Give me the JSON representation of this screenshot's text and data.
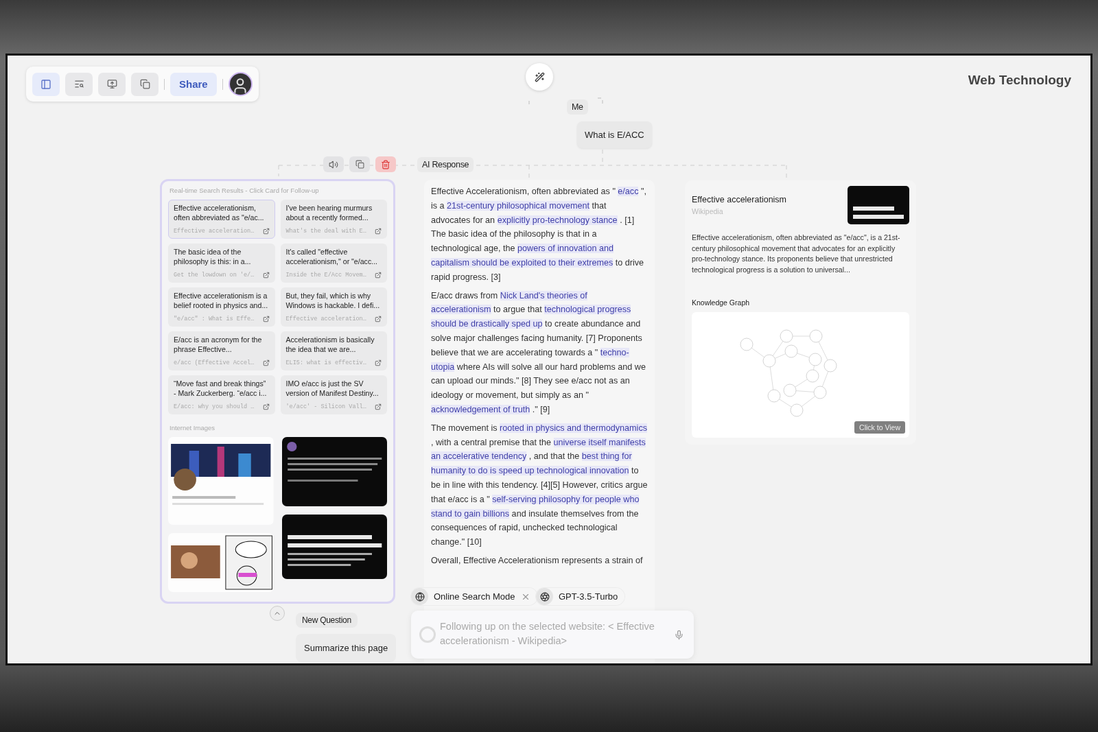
{
  "toolbar": {
    "buttons": [
      {
        "kind": "sidebar",
        "selected": true
      },
      {
        "kind": "search",
        "selected": false
      },
      {
        "kind": "add",
        "selected": false
      },
      {
        "kind": "copy",
        "selected": false
      }
    ],
    "share": "Share"
  },
  "page_title": "Web Technology",
  "tree": {
    "user_label": "Me",
    "question": "What is E/ACC",
    "response_label": "AI Response"
  },
  "actions": [
    {
      "kind": "speaker"
    },
    {
      "kind": "copy"
    },
    {
      "kind": "delete"
    }
  ],
  "search_panel": {
    "title": "Real-time Search Results - Click Card for Follow-up",
    "results": [
      {
        "title": "Effective accelerationism, often abbreviated as \"e/ac...",
        "source": "Effective acceleration…",
        "selected": true
      },
      {
        "title": "I've been hearing murmurs about a recently formed...",
        "source": "What's the deal with E…",
        "selected": false
      },
      {
        "title": "The basic idea of the philosophy is this: in a...",
        "source": "Get the lowdown on 'e/…",
        "selected": false
      },
      {
        "title": "It's called \"effective accelerationism,\" or \"e/acc...",
        "source": "Inside the E/Acc Movem…",
        "selected": false
      },
      {
        "title": "Effective accelerationism is a belief rooted in physics and...",
        "source": "\"e/acc\" : What is Effe…",
        "selected": false
      },
      {
        "title": "But, they fail, which is why Windows is hackable. I defi...",
        "source": "Effective acceleration…",
        "selected": false
      },
      {
        "title": "E/acc is an acronym for the phrase Effective...",
        "source": "e/acc (Effective Accel…",
        "selected": false
      },
      {
        "title": "Accelerationism is basically the idea that we are...",
        "source": "ELI5: what is effectiv…",
        "selected": false
      },
      {
        "title": "“Move fast and break things” - Mark Zuckerberg. “e/acc i...",
        "source": "E/acc: why you should …",
        "selected": false
      },
      {
        "title": "IMO e/acc is just the SV version of Manifest Destiny...",
        "source": "'e/acc' - Silicon Vall…",
        "selected": false
      }
    ],
    "images_label": "Internet Images"
  },
  "answer": {
    "paragraphs": [
      [
        {
          "text": "Effective Accelerationism, often abbreviated as \" ",
          "highlight": false
        },
        {
          "text": "e/acc",
          "highlight": true
        },
        {
          "text": " \", is a ",
          "highlight": false
        },
        {
          "text": "21st-century philosophical movement",
          "highlight": true
        },
        {
          "text": " that advocates for an ",
          "highlight": false
        },
        {
          "text": "explicitly pro-technology stance",
          "highlight": true
        },
        {
          "text": " . [1] The basic idea of the philosophy is that in a technological age, the ",
          "highlight": false
        },
        {
          "text": "powers of innovation and capitalism should be exploited to their extremes",
          "highlight": true
        },
        {
          "text": " to drive rapid progress. [3]",
          "highlight": false
        }
      ],
      [
        {
          "text": "E/acc draws from ",
          "highlight": false
        },
        {
          "text": "Nick Land's theories of accelerationism",
          "highlight": true
        },
        {
          "text": " to argue that ",
          "highlight": false
        },
        {
          "text": "technological progress should be drastically sped up",
          "highlight": true
        },
        {
          "text": " to create abundance and solve major challenges facing humanity. [7] Proponents believe that we are accelerating towards a \" ",
          "highlight": false
        },
        {
          "text": "techno-utopia",
          "highlight": true
        },
        {
          "text": " where AIs will solve all our hard problems and we can upload our minds.\" [8] They see e/acc not as an ideology or movement, but simply as an \" ",
          "highlight": false
        },
        {
          "text": "acknowledgement of truth",
          "highlight": true
        },
        {
          "text": " .\" [9]",
          "highlight": false
        }
      ],
      [
        {
          "text": "The movement is ",
          "highlight": false
        },
        {
          "text": "rooted in physics and thermodynamics",
          "highlight": true
        },
        {
          "text": " , with a central premise that the ",
          "highlight": false
        },
        {
          "text": "universe itself manifests an accelerative tendency",
          "highlight": true
        },
        {
          "text": " , and that the ",
          "highlight": false
        },
        {
          "text": "best thing for humanity to do is speed up technological innovation",
          "highlight": true
        },
        {
          "text": " to be in line with this tendency. [4][5] However, critics argue that e/acc is a \" ",
          "highlight": false
        },
        {
          "text": "self-serving philosophy for people who stand to gain billions",
          "highlight": true
        },
        {
          "text": " and insulate themselves from the consequences of rapid, unchecked technological change.\" [10]",
          "highlight": false
        }
      ],
      [
        {
          "text": "Overall, Effective Accelerationism represents a strain of",
          "highlight": false
        }
      ]
    ]
  },
  "chips": [
    {
      "kind": "globe",
      "label": "Online Search Mode",
      "removable": true
    },
    {
      "kind": "model",
      "label": "GPT-3.5-Turbo",
      "removable": false
    }
  ],
  "input": {
    "placeholder": "Following up on the selected website: < Effective accelerationism - Wikipedia>"
  },
  "follow_ups": {
    "new_question": "New Question",
    "suggestions": [
      "Summarize this page"
    ]
  },
  "source_card": {
    "title": "Effective accelerationism",
    "source": "Wikipedia",
    "summary": "Effective accelerationism, often abbreviated as \"e/acc\", is a 21st-century philosophical movement that advocates for an explicitly pro-technology stance. Its proponents believe that unrestricted technological progress is a solution to universal...",
    "graph_label": "Knowledge Graph",
    "view_button": "Click to View"
  }
}
